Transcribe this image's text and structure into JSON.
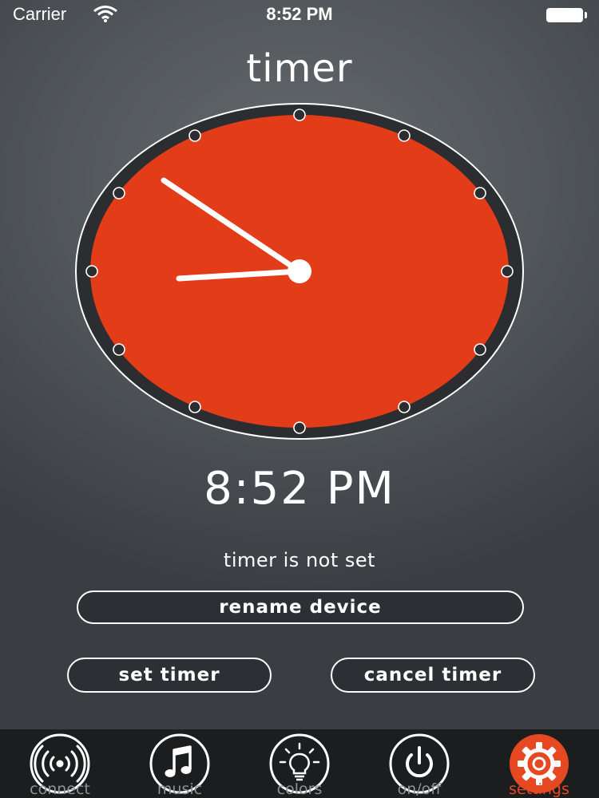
{
  "status_bar": {
    "carrier": "Carrier",
    "time": "8:52 PM"
  },
  "title": "timer",
  "dial": {
    "face_color": "#e23c19",
    "hand_color": "#ffffff",
    "displayed_time": "8:52"
  },
  "time_display": "8:52 PM",
  "timer_status": "timer is not set",
  "buttons": {
    "rename": "rename device",
    "set_timer": "set timer",
    "cancel_timer": "cancel timer"
  },
  "tabs": [
    {
      "label": "connect",
      "icon": "broadcast-icon",
      "active": false
    },
    {
      "label": "music",
      "icon": "music-note-icon",
      "active": false
    },
    {
      "label": "colors",
      "icon": "lightbulb-icon",
      "active": false
    },
    {
      "label": "on/off",
      "icon": "power-icon",
      "active": false
    },
    {
      "label": "settings",
      "icon": "gear-icon",
      "active": true
    }
  ],
  "colors": {
    "accent": "#e64822",
    "tab_inactive": "#8d9196"
  }
}
